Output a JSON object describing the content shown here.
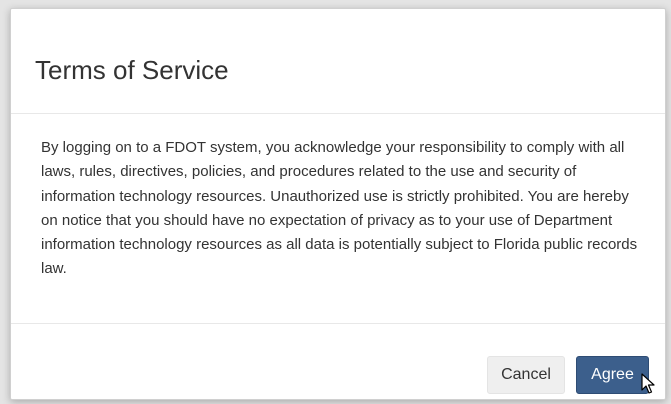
{
  "dialog": {
    "title": "Terms of Service",
    "body": "By logging on to a FDOT system, you acknowledge your responsibility to comply with all laws, rules, directives, policies, and procedures related to the use and security of information technology resources. Unauthorized use is strictly prohibited. You are hereby on notice that you should have no expectation of privacy as to your use of Department information technology resources as all data is potentially subject to Florida public records law.",
    "cancel_label": "Cancel",
    "agree_label": "Agree"
  },
  "colors": {
    "agree_button_bg": "#3c5f8c",
    "cancel_button_bg": "#efefef"
  },
  "cursor": "arrow-pointer-icon"
}
